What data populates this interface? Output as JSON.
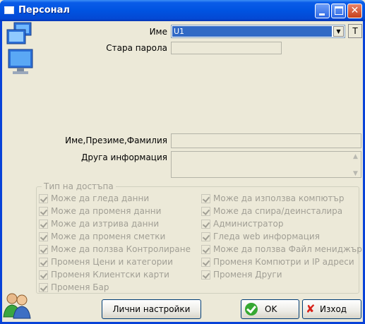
{
  "window": {
    "title": "Персонал"
  },
  "form": {
    "name_label": "Име",
    "name_value": "U1",
    "t_button": "T",
    "old_password_label": "Стара парола",
    "fullname_label": "Име,Презиме,Фамилия",
    "other_info_label": "Друга информация"
  },
  "access": {
    "title": "Тип на достъпа",
    "left": [
      "Може да гледа данни",
      "Може да променя данни",
      "Може да изтрива данни",
      "Може да променя сметки",
      "Може да ползва Контролиране",
      "Променя Цени и категории",
      "Променя Клиентски карти",
      "Променя Бар"
    ],
    "right": [
      "Може да използва компютър",
      "Може да спира/деинсталира",
      "Администратор",
      "Гледа web информация",
      "Може да ползва Файл мениджър",
      "Променя Компютри и IP адреси",
      "Променя Други"
    ]
  },
  "buttons": {
    "personal_settings": "Лични настройки",
    "ok": "OK",
    "exit": "Изход"
  }
}
